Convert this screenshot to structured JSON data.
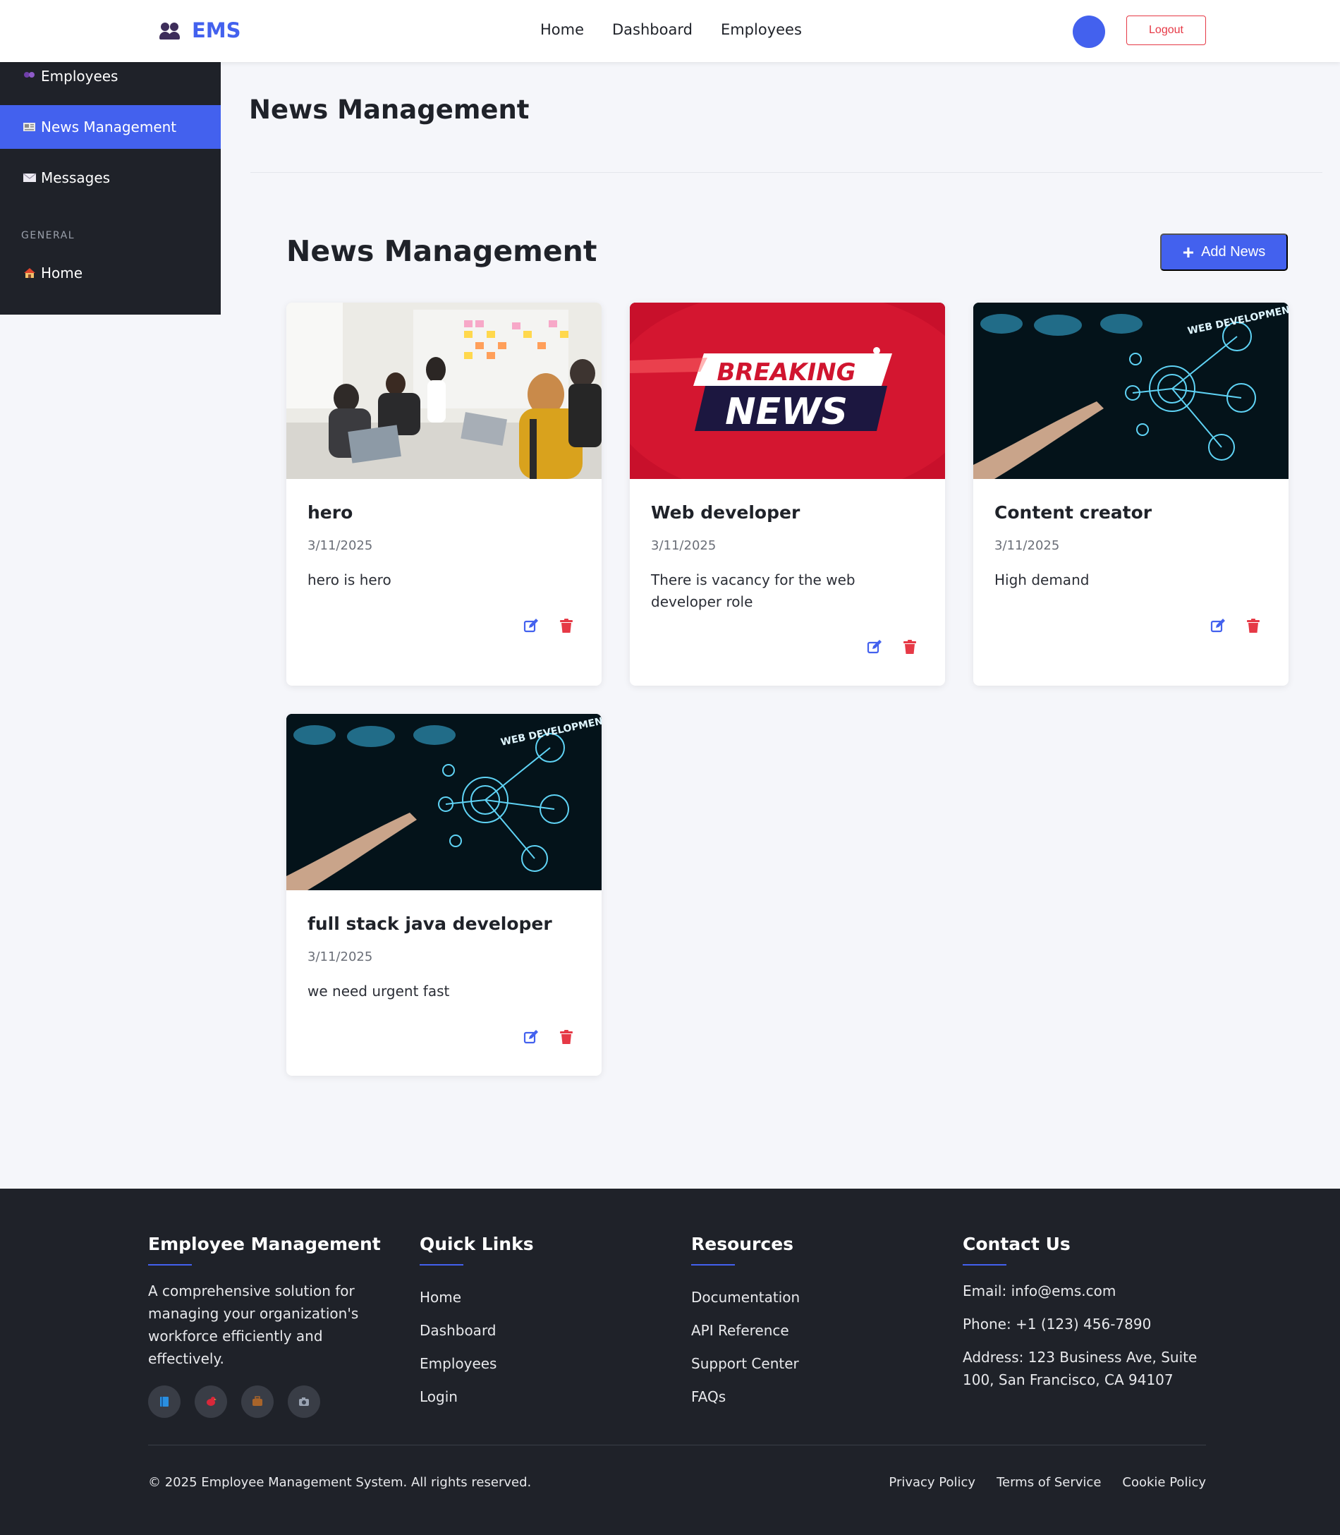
{
  "header": {
    "brand": "EMS",
    "nav": [
      "Home",
      "Dashboard",
      "Employees"
    ],
    "logout_label": "Logout"
  },
  "sidebar": {
    "items": [
      {
        "label": "Employees",
        "icon": "people-icon"
      },
      {
        "label": "News Management",
        "icon": "newspaper-icon",
        "active": true
      },
      {
        "label": "Messages",
        "icon": "envelope-icon"
      }
    ],
    "section_label": "GENERAL",
    "general_items": [
      {
        "label": "Home",
        "icon": "house-icon"
      }
    ]
  },
  "main": {
    "page_title": "News Management",
    "section_title": "News Management",
    "add_label": "Add News",
    "cards": [
      {
        "title": "hero",
        "date": "3/11/2025",
        "description": "hero is hero",
        "image": "office-meeting-image"
      },
      {
        "title": "Web developer",
        "date": "3/11/2025",
        "description": "There is vacancy for the web developer role",
        "image": "breaking-news-image",
        "image_text_1": "BREAKING",
        "image_text_2": "NEWS"
      },
      {
        "title": "Content creator",
        "date": "3/11/2025",
        "description": "High demand",
        "image": "web-development-image",
        "image_text": "WEB DEVELOPMENT"
      },
      {
        "title": "full stack java developer",
        "date": "3/11/2025",
        "description": "we need urgent fast",
        "image": "web-development-image",
        "image_text": "WEB DEVELOPMENT"
      }
    ]
  },
  "footer": {
    "about": {
      "heading": "Employee Management",
      "text": "A comprehensive solution for managing your organization's workforce efficiently and effectively.",
      "socials": [
        "book-icon",
        "bird-icon",
        "briefcase-icon",
        "camera-icon"
      ]
    },
    "quick_links": {
      "heading": "Quick Links",
      "items": [
        "Home",
        "Dashboard",
        "Employees",
        "Login"
      ]
    },
    "resources": {
      "heading": "Resources",
      "items": [
        "Documentation",
        "API Reference",
        "Support Center",
        "FAQs"
      ]
    },
    "contact": {
      "heading": "Contact Us",
      "email": "Email: info@ems.com",
      "phone": "Phone: +1 (123) 456-7890",
      "address": "Address: 123 Business Ave, Suite 100, San Francisco, CA 94107"
    },
    "copyright": "© 2025 Employee Management System. All rights reserved.",
    "legal": [
      "Privacy Policy",
      "Terms of Service",
      "Cookie Policy"
    ]
  },
  "colors": {
    "accent": "#4361ee",
    "danger": "#e63946",
    "dark": "#1f2229"
  }
}
